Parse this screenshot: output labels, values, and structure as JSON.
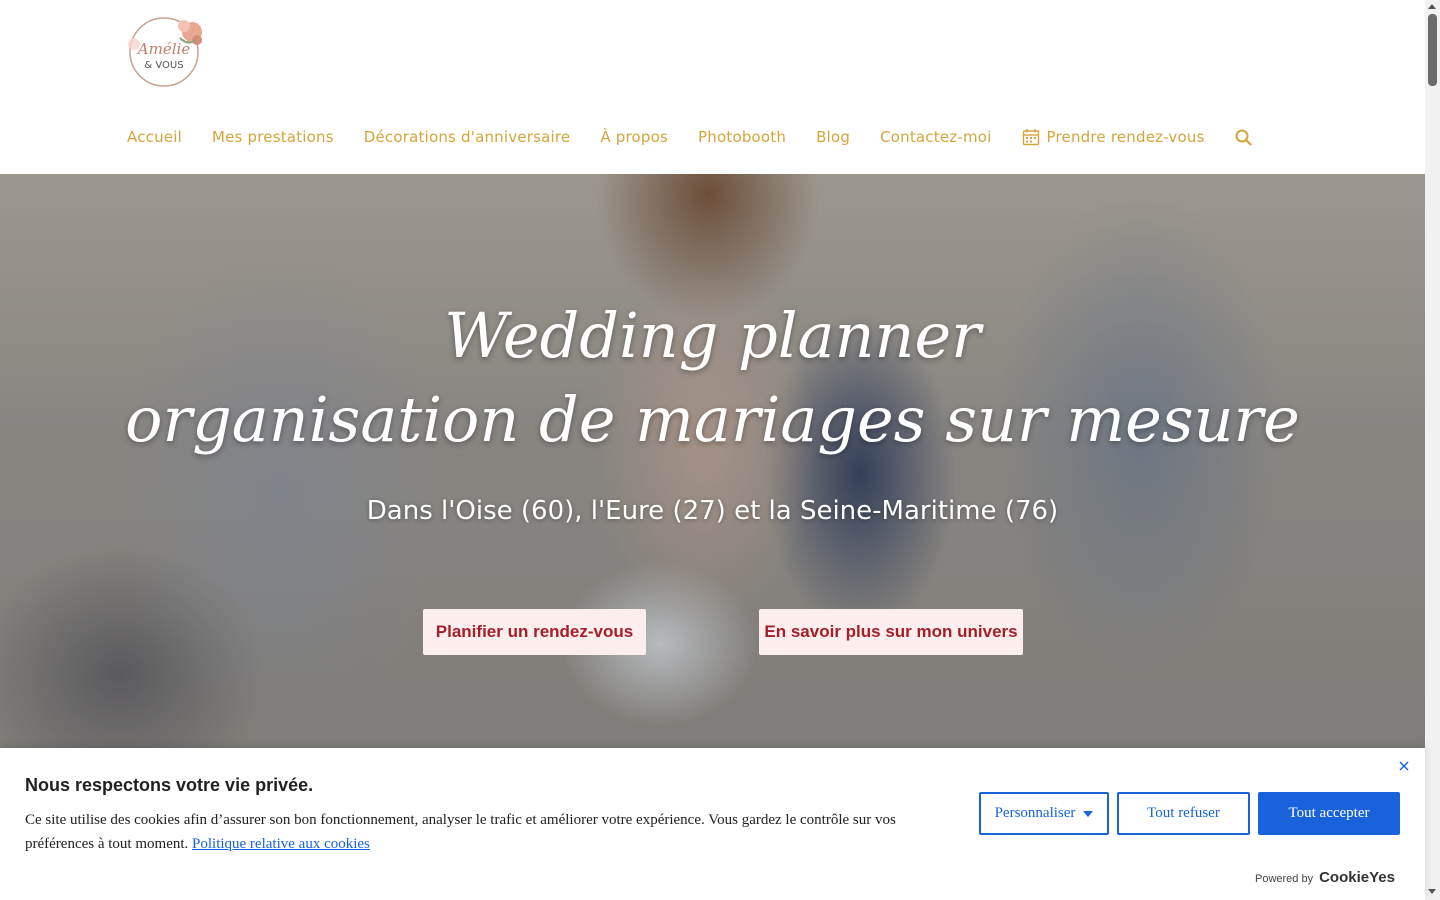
{
  "header": {
    "logo_text_1": "Amélie",
    "logo_text_2": "& VOUS",
    "nav": [
      {
        "label": "Accueil"
      },
      {
        "label": "Mes prestations"
      },
      {
        "label": "Décorations d'anniversaire"
      },
      {
        "label": "À propos"
      },
      {
        "label": "Photobooth"
      },
      {
        "label": "Blog"
      },
      {
        "label": "Contactez-moi"
      },
      {
        "label": "Prendre rendez-vous",
        "icon": "calendar-icon"
      }
    ],
    "search_icon": "search-icon",
    "nav_color": "#d4a53a"
  },
  "hero": {
    "title_line1": "Wedding planner",
    "title_line2": "organisation de mariages sur mesure",
    "subtitle": "Dans l'Oise (60), l'Eure (27) et la Seine-Maritime (76)",
    "button_primary": "Planifier un rendez-vous",
    "button_secondary": "En savoir plus sur mon univers",
    "button_bg": "#fdeeee",
    "button_text_color": "#a31f2c"
  },
  "cookie_banner": {
    "title": "Nous respectons votre vie privée.",
    "text": "Ce site utilise des cookies afin d’assurer son bon fonctionnement, analyser le trafic et améliorer votre expérience. Vous gardez le contrôle sur vos préférences à tout moment.",
    "policy_link": "Politique relative aux cookies",
    "customize_label": "Personnaliser",
    "reject_label": "Tout refuser",
    "accept_label": "Tout accepter",
    "powered_by": "Powered by",
    "powered_brand": "CookieYes",
    "accent_color": "#1863dc"
  }
}
